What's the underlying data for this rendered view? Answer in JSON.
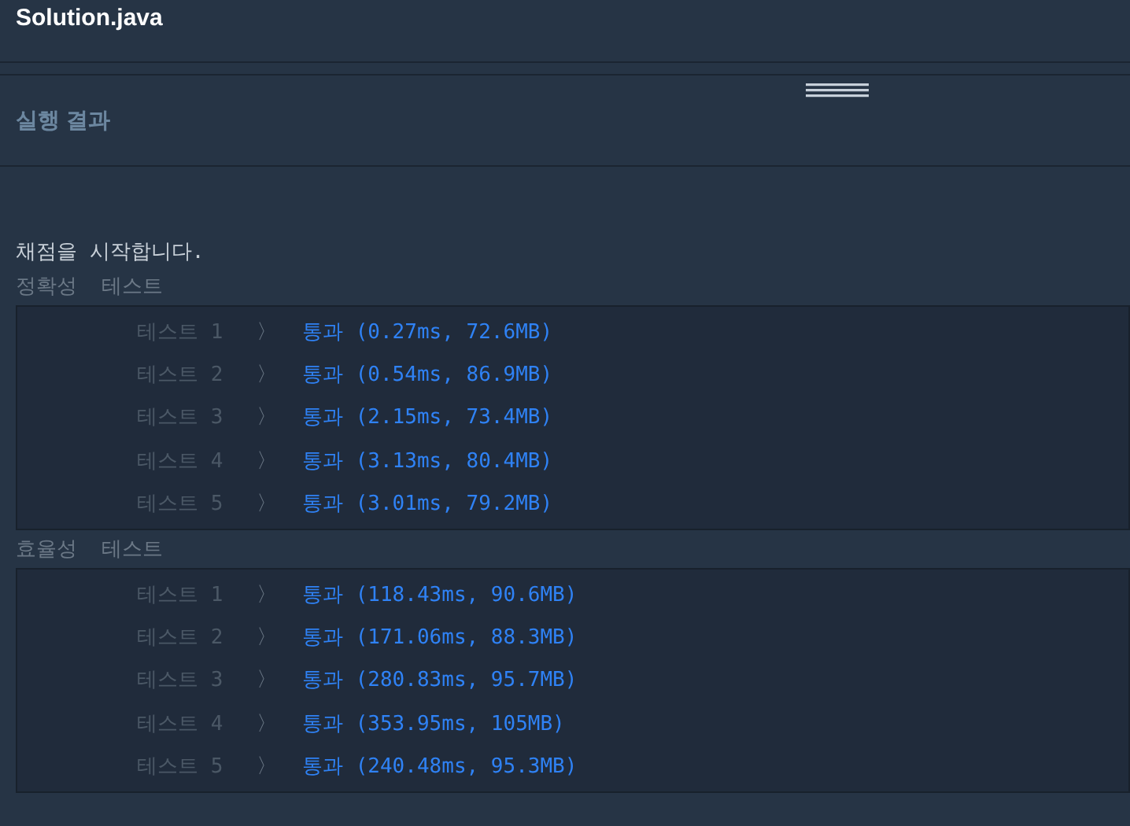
{
  "editor": {
    "filename": "Solution.java"
  },
  "results_panel": {
    "title": "실행 결과"
  },
  "output": {
    "message": "채점을 시작합니다.",
    "groups": [
      {
        "title": "정확성  테스트",
        "tests": [
          {
            "label": "테스트 1",
            "separator": "〉",
            "result": "통과 (0.27ms, 72.6MB)"
          },
          {
            "label": "테스트 2",
            "separator": "〉",
            "result": "통과 (0.54ms, 86.9MB)"
          },
          {
            "label": "테스트 3",
            "separator": "〉",
            "result": "통과 (2.15ms, 73.4MB)"
          },
          {
            "label": "테스트 4",
            "separator": "〉",
            "result": "통과 (3.13ms, 80.4MB)"
          },
          {
            "label": "테스트 5",
            "separator": "〉",
            "result": "통과 (3.01ms, 79.2MB)"
          }
        ]
      },
      {
        "title": "효율성  테스트",
        "tests": [
          {
            "label": "테스트 1",
            "separator": "〉",
            "result": "통과 (118.43ms, 90.6MB)"
          },
          {
            "label": "테스트 2",
            "separator": "〉",
            "result": "통과 (171.06ms, 88.3MB)"
          },
          {
            "label": "테스트 3",
            "separator": "〉",
            "result": "통과 (280.83ms, 95.7MB)"
          },
          {
            "label": "테스트 4",
            "separator": "〉",
            "result": "통과 (353.95ms, 105MB)"
          },
          {
            "label": "테스트 5",
            "separator": "〉",
            "result": "통과 (240.48ms, 95.3MB)"
          }
        ]
      }
    ]
  }
}
